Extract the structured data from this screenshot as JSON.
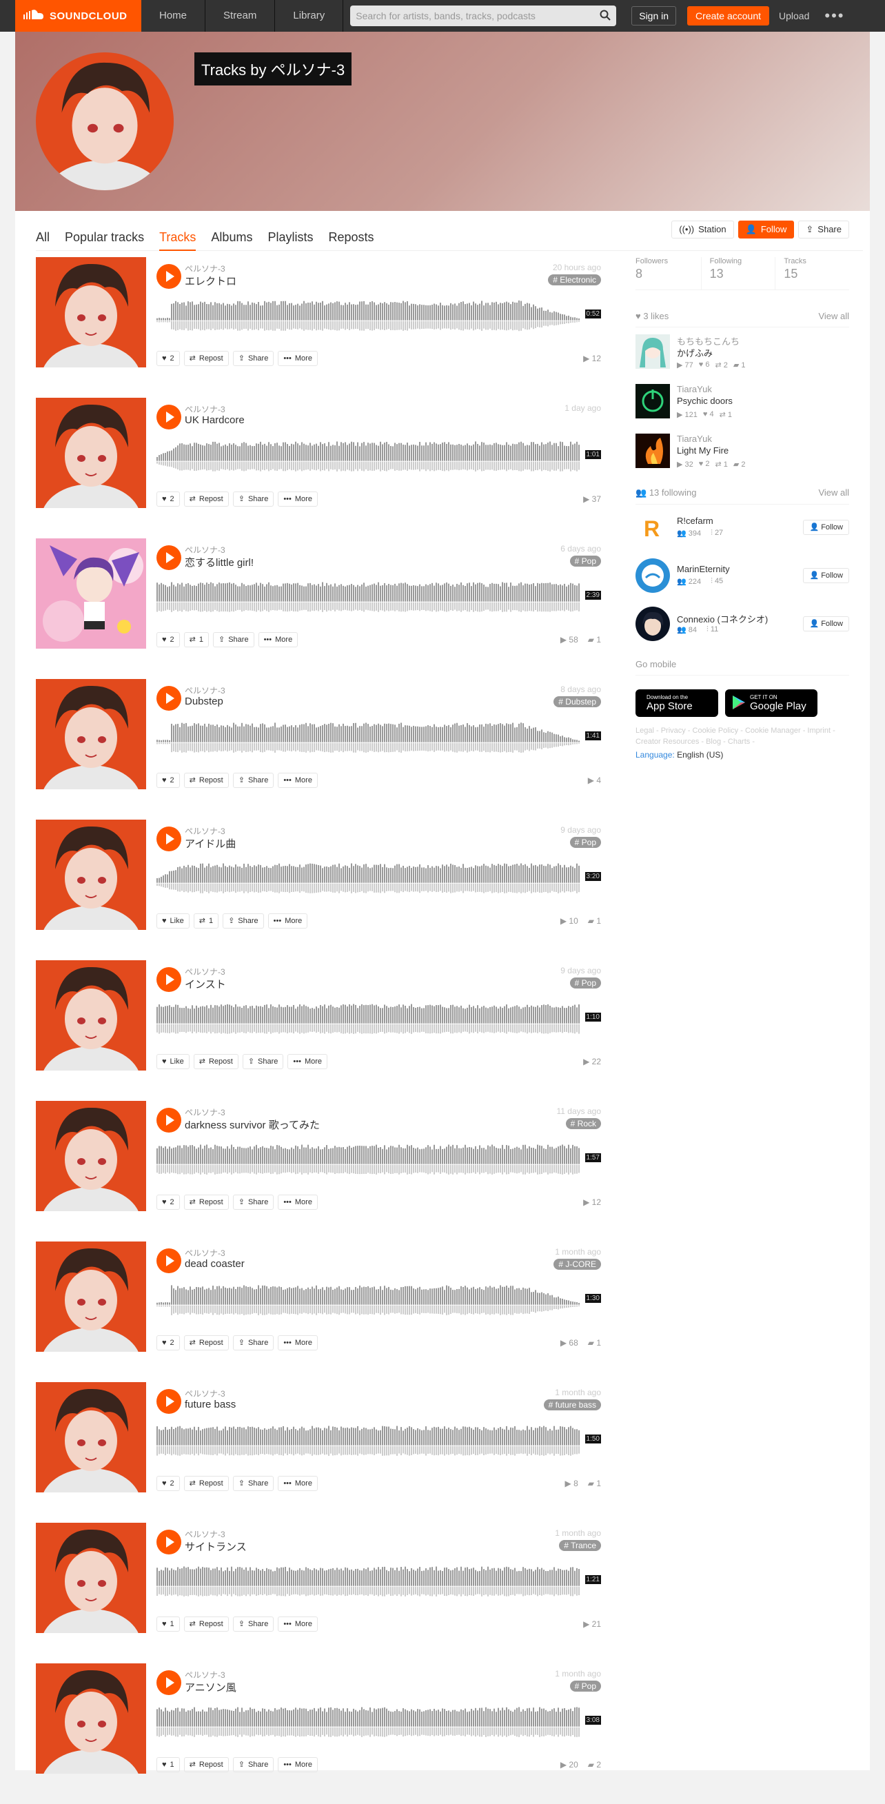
{
  "header": {
    "logo_text": "SOUNDCLOUD",
    "nav": [
      "Home",
      "Stream",
      "Library"
    ],
    "search_placeholder": "Search for artists, bands, tracks, podcasts",
    "signin": "Sign in",
    "create": "Create account",
    "upload": "Upload",
    "more": "•••"
  },
  "hero": {
    "title": "Tracks by ペルソナ-3"
  },
  "tabs": [
    {
      "label": "All"
    },
    {
      "label": "Popular tracks"
    },
    {
      "label": "Tracks",
      "active": true
    },
    {
      "label": "Albums"
    },
    {
      "label": "Playlists"
    },
    {
      "label": "Reposts"
    }
  ],
  "hero_actions": {
    "station": "Station",
    "follow": "Follow",
    "share": "Share"
  },
  "action_labels": {
    "repost": "Repost",
    "share": "Share",
    "more": "More",
    "like": "Like"
  },
  "tracks": [
    {
      "user": "ペルソナ-3",
      "title": "エレクトロ",
      "date": "20 hours ago",
      "tag": "# Electronic",
      "duration": "0:52",
      "likes": "2",
      "reposts": "",
      "plays": "12",
      "comments": "",
      "art": "persona"
    },
    {
      "user": "ペルソナ-3",
      "title": "UK Hardcore",
      "date": "1 day ago",
      "tag": "",
      "duration": "1:01",
      "likes": "2",
      "reposts": "",
      "plays": "37",
      "comments": "",
      "art": "persona"
    },
    {
      "user": "ペルソナ-3",
      "title": "恋するlittle girl!",
      "date": "6 days ago",
      "tag": "# Pop",
      "duration": "2:39",
      "likes": "2",
      "reposts": "1",
      "plays": "58",
      "comments": "1",
      "art": "anime"
    },
    {
      "user": "ペルソナ-3",
      "title": "Dubstep",
      "date": "8 days ago",
      "tag": "# Dubstep",
      "duration": "1:41",
      "likes": "2",
      "reposts": "",
      "plays": "4",
      "comments": "",
      "art": "persona"
    },
    {
      "user": "ペルソナ-3",
      "title": "アイドル曲",
      "date": "9 days ago",
      "tag": "# Pop",
      "duration": "3:20",
      "likes": "Like",
      "reposts": "1",
      "plays": "10",
      "comments": "1",
      "art": "persona"
    },
    {
      "user": "ペルソナ-3",
      "title": "インスト",
      "date": "9 days ago",
      "tag": "# Pop",
      "duration": "1:10",
      "likes": "Like",
      "reposts": "",
      "plays": "22",
      "comments": "",
      "art": "persona"
    },
    {
      "user": "ペルソナ-3",
      "title": "darkness survivor 歌ってみた",
      "date": "11 days ago",
      "tag": "# Rock",
      "duration": "1:57",
      "likes": "2",
      "reposts": "",
      "plays": "12",
      "comments": "",
      "art": "persona"
    },
    {
      "user": "ペルソナ-3",
      "title": "dead coaster",
      "date": "1 month ago",
      "tag": "# J-CORE",
      "duration": "1:30",
      "likes": "2",
      "reposts": "",
      "plays": "68",
      "comments": "1",
      "art": "persona"
    },
    {
      "user": "ペルソナ-3",
      "title": "future bass",
      "date": "1 month ago",
      "tag": "# future bass",
      "duration": "1:50",
      "likes": "2",
      "reposts": "",
      "plays": "8",
      "comments": "1",
      "art": "persona"
    },
    {
      "user": "ペルソナ-3",
      "title": "サイトランス",
      "date": "1 month ago",
      "tag": "# Trance",
      "duration": "1:21",
      "likes": "1",
      "reposts": "",
      "plays": "21",
      "comments": "",
      "art": "persona"
    },
    {
      "user": "ペルソナ-3",
      "title": "アニソン風",
      "date": "1 month ago",
      "tag": "# Pop",
      "duration": "3:08",
      "likes": "1",
      "reposts": "",
      "plays": "20",
      "comments": "2",
      "art": "persona"
    }
  ],
  "sidebar": {
    "stats": [
      {
        "label": "Followers",
        "value": "8"
      },
      {
        "label": "Following",
        "value": "13"
      },
      {
        "label": "Tracks",
        "value": "15"
      }
    ],
    "likes_head": "3 likes",
    "view_all": "View all",
    "likes": [
      {
        "user": "もちもちこんち",
        "title": "かげふみ",
        "plays": "77",
        "likes": "6",
        "reposts": "2",
        "comments": "1"
      },
      {
        "user": "TiaraYuk",
        "title": "Psychic doors",
        "plays": "121",
        "likes": "4",
        "reposts": "1",
        "comments": ""
      },
      {
        "user": "TiaraYuk",
        "title": "Light My Fire",
        "plays": "32",
        "likes": "2",
        "reposts": "1",
        "comments": "2"
      }
    ],
    "following_head": "13 following",
    "following": [
      {
        "name": "R!cefarm",
        "followers": "394",
        "tracks": "27"
      },
      {
        "name": "MarinEternity",
        "followers": "224",
        "tracks": "45"
      },
      {
        "name": "Connexio (コネクシオ)",
        "followers": "84",
        "tracks": "11"
      }
    ],
    "follow_label": "Follow",
    "go_mobile": "Go mobile",
    "app_store_small": "Download on the",
    "app_store_big": "App Store",
    "play_small": "GET IT ON",
    "play_big": "Google Play",
    "legal": "Legal - Privacy - Cookie Policy - Cookie Manager - Imprint - Creator Resources - Blog - Charts -",
    "language_label": "Language:",
    "language_value": "English (US)"
  }
}
